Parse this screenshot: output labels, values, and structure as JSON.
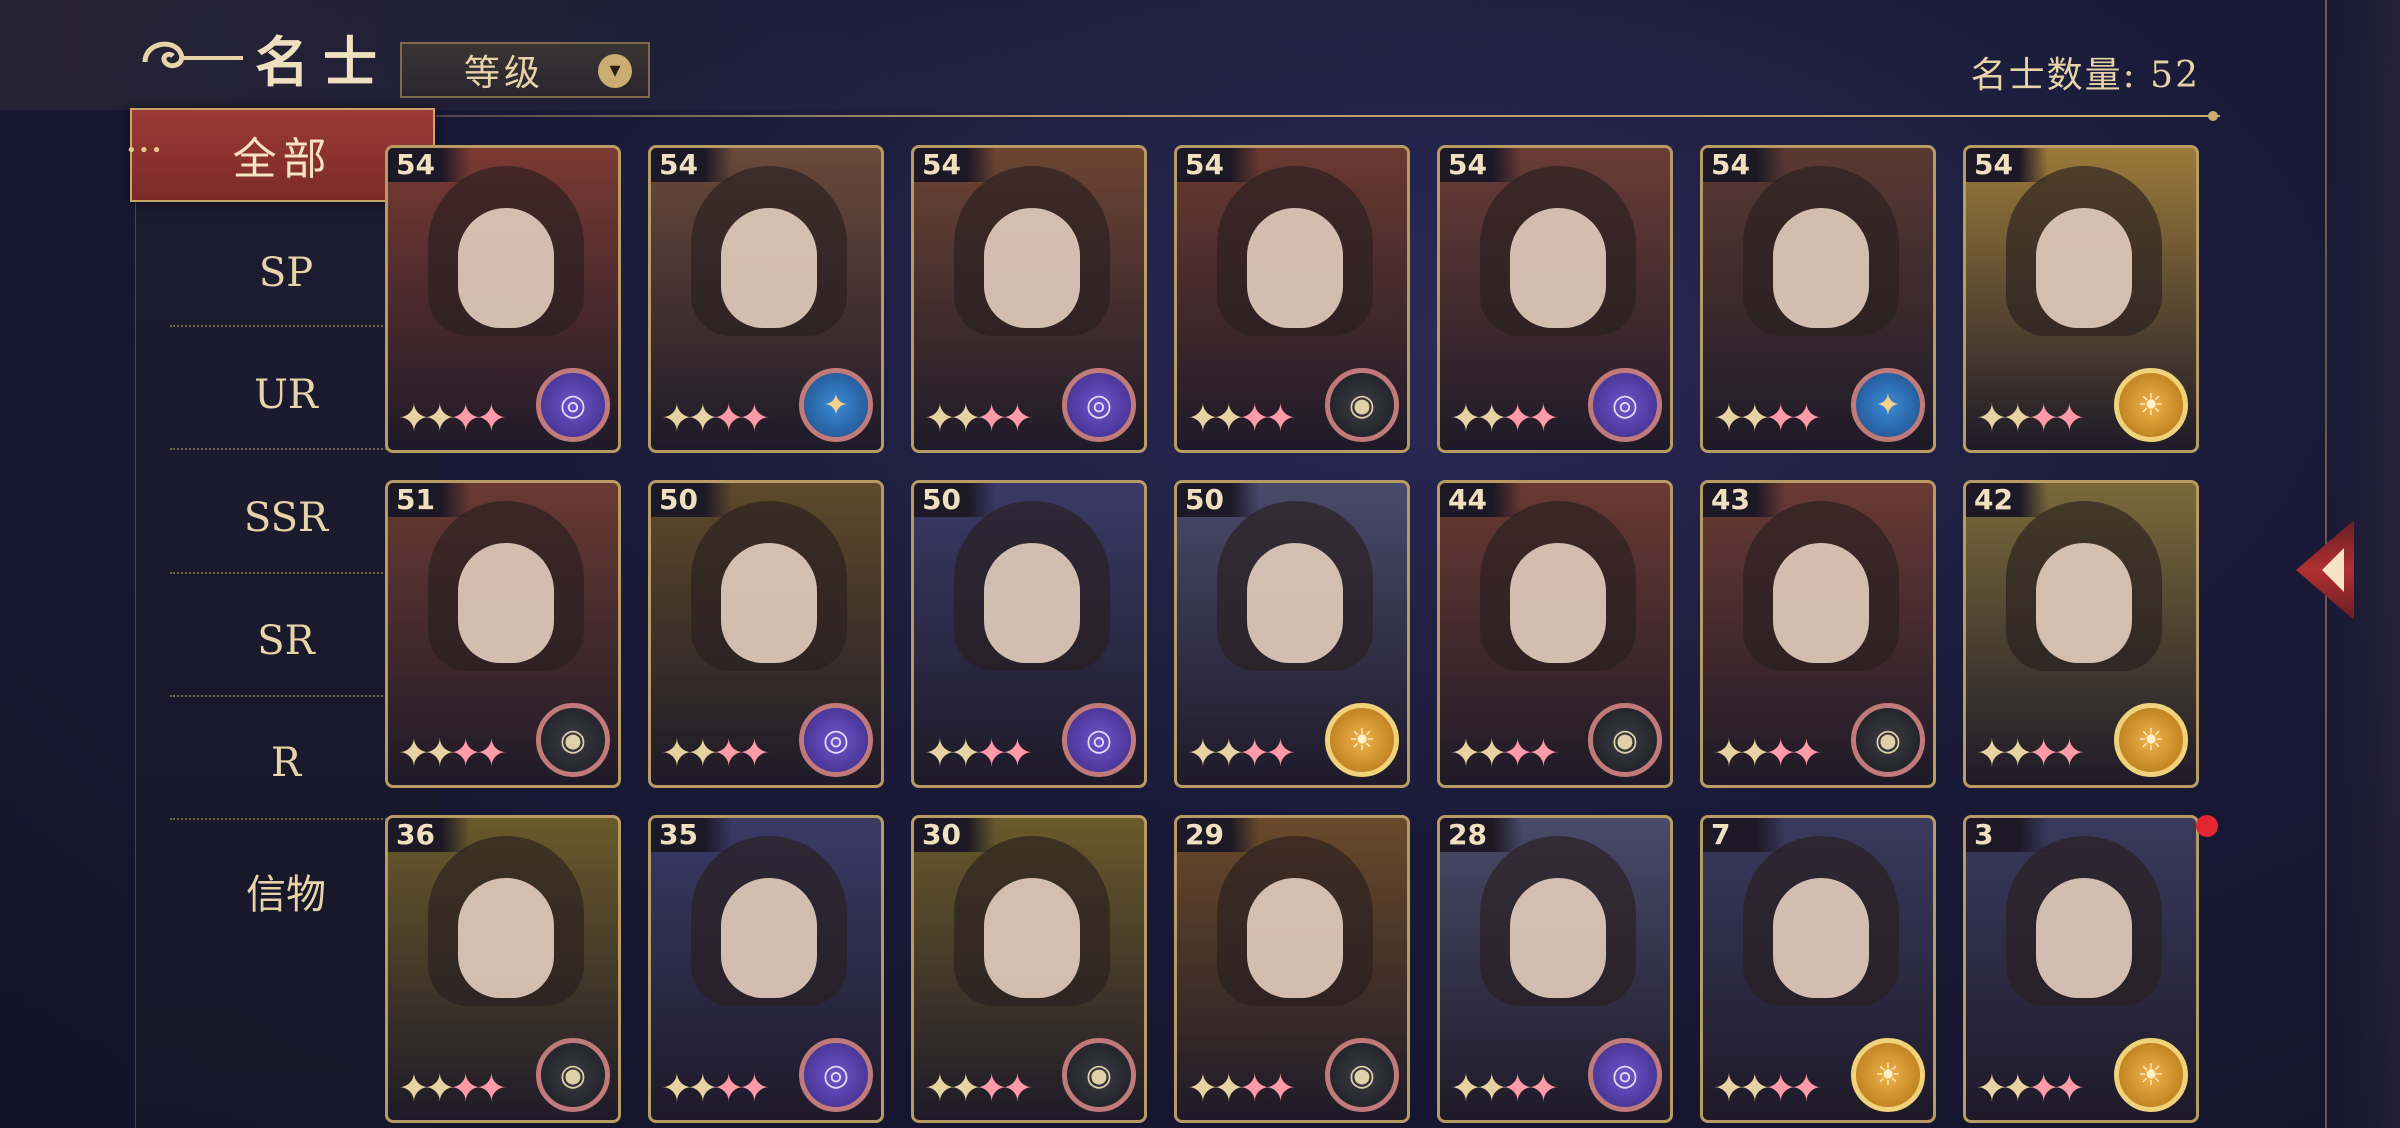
{
  "header": {
    "title": "名士",
    "dropdown_label": "等级",
    "count_label": "名士数量: 52"
  },
  "sidebar": {
    "items": [
      {
        "label": "全部"
      },
      {
        "label": "SP"
      },
      {
        "label": "UR"
      },
      {
        "label": "SSR"
      },
      {
        "label": "SR"
      },
      {
        "label": "R"
      },
      {
        "label": "信物"
      }
    ]
  },
  "cards": [
    {
      "level": "54",
      "badge": "purple",
      "bg": "#7a3a32"
    },
    {
      "level": "54",
      "badge": "blue",
      "bg": "#6a4a3a"
    },
    {
      "level": "54",
      "badge": "purple",
      "bg": "#6d4433"
    },
    {
      "level": "54",
      "badge": "dark",
      "bg": "#6a3a30"
    },
    {
      "level": "54",
      "badge": "purple",
      "bg": "#6a3d36"
    },
    {
      "level": "54",
      "badge": "blue",
      "bg": "#5a3a32"
    },
    {
      "level": "54",
      "badge": "gold",
      "bg": "#9a7a3a"
    },
    {
      "level": "51",
      "badge": "dark",
      "bg": "#6a3a32"
    },
    {
      "level": "50",
      "badge": "purple",
      "bg": "#5e4a2a"
    },
    {
      "level": "50",
      "badge": "purple",
      "bg": "#3a3a66"
    },
    {
      "level": "50",
      "badge": "gold",
      "bg": "#4a4a6a"
    },
    {
      "level": "44",
      "badge": "dark",
      "bg": "#6a3a32"
    },
    {
      "level": "43",
      "badge": "dark",
      "bg": "#6a3a34"
    },
    {
      "level": "42",
      "badge": "gold",
      "bg": "#7a6a3a"
    },
    {
      "level": "36",
      "badge": "dark",
      "bg": "#6a5a2a"
    },
    {
      "level": "35",
      "badge": "purple",
      "bg": "#3a3a66"
    },
    {
      "level": "30",
      "badge": "dark",
      "bg": "#6a5a2a"
    },
    {
      "level": "29",
      "badge": "dark",
      "bg": "#6a4a2a"
    },
    {
      "level": "28",
      "badge": "purple",
      "bg": "#4a4a6a"
    },
    {
      "level": "7",
      "badge": "gold",
      "bg": "#3a3a5e"
    },
    {
      "level": "3",
      "badge": "gold",
      "bg": "#3a3a5e"
    }
  ],
  "colors": {
    "accent_red": "#9b3a36",
    "gold": "#c9ad73",
    "notification": "#e32630"
  }
}
